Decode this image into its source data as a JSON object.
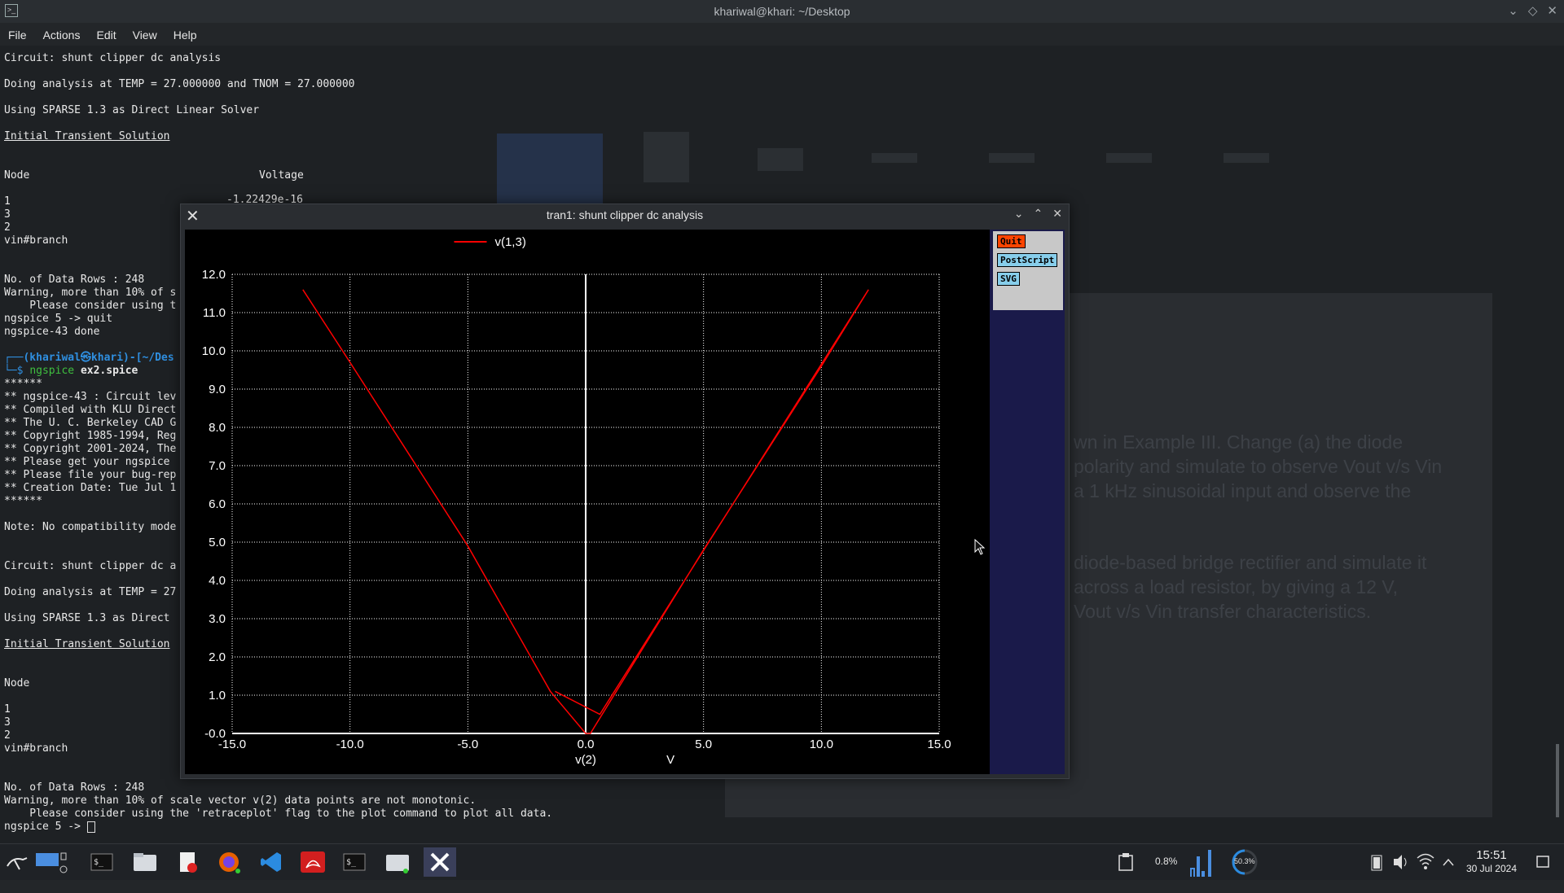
{
  "window": {
    "title": "khariwal@khari: ~/Desktop",
    "app_icon": "terminal-icon"
  },
  "menu": [
    "File",
    "Actions",
    "Edit",
    "View",
    "Help"
  ],
  "terminal_lines": [
    "Circuit: shunt clipper dc analysis",
    "Doing analysis at TEMP = 27.000000 and TNOM = 27.000000",
    "Using SPARSE 1.3 as Direct Linear Solver",
    "Initial Transient Solution",
    "Node",
    "Voltage",
    "-1.22429e-16",
    "1",
    "3",
    "2",
    "vin#branch",
    "No. of Data Rows : 248",
    "Warning, more than 10% of s",
    "    Please consider using t",
    "ngspice 5 -> quit",
    "ngspice-43 done",
    "┌──(khariwal㉿khari)-[~/Des",
    "└─$ ngspice ex2.spice",
    "******",
    "** ngspice-43 : Circuit lev",
    "** Compiled with KLU Direct",
    "** The U. C. Berkeley CAD G",
    "** Copyright 1985-1994, Reg",
    "** Copyright 2001-2024, The",
    "** Please get your ngspice ",
    "** Please file your bug-rep",
    "** Creation Date: Tue Jul 1",
    "******",
    "Note: No compatibility mode",
    "Circuit: shunt clipper dc a",
    "Doing analysis at TEMP = 27",
    "Using SPARSE 1.3 as Direct ",
    "Initial Transient Solution",
    "Node",
    "1",
    "3",
    "2",
    "vin#branch",
    "No. of Data Rows : 248",
    "Warning, more than 10% of scale vector v(2) data points are not monotonic.",
    "    Please consider using the 'retraceplot' flag to the plot command to plot all data.",
    "ngspice 5 -> "
  ],
  "prompt": {
    "user": "khariwal㉿khari",
    "cmd": "ngspice",
    "arg": "ex2.spice"
  },
  "bg_doc_lines": [
    "wn in Example III. Change (a) the diode",
    "polarity and simulate to observe Vout v/s Vin",
    "a 1 kHz sinusoidal input and observe the",
    "diode-based bridge rectifier and simulate it",
    "across a load resistor, by giving a 12 V,",
    "Vout v/s Vin transfer characteristics."
  ],
  "plot_window": {
    "title": "tran1: shunt clipper dc analysis",
    "buttons": [
      "Quit",
      "PostScript",
      "SVG"
    ],
    "colors": {
      "background": "#000000",
      "trace": "#ff0000",
      "grid": "#ffffff",
      "panel": "#1a1a4a"
    }
  },
  "chart_data": {
    "type": "line",
    "xlabel": "v(2)",
    "xunit": "V",
    "xlim": [
      -15,
      15
    ],
    "ylim": [
      0,
      12
    ],
    "xticks": [
      "-15.0",
      "-10.0",
      "-5.0",
      "0.0",
      "5.0",
      "10.0",
      "15.0"
    ],
    "yticks": [
      "-0.0",
      "1.0",
      "2.0",
      "3.0",
      "4.0",
      "5.0",
      "6.0",
      "7.0",
      "8.0",
      "9.0",
      "10.0",
      "11.0",
      "12.0"
    ],
    "grid": true,
    "legend": "top-center",
    "series": [
      {
        "name": "v(1,3)",
        "color": "#ff0000",
        "x": [
          -12.0,
          -10.0,
          -5.0,
          -1.5,
          0.0,
          0.2,
          5.0,
          10.0,
          12.0,
          0.6,
          -1.3
        ],
        "y": [
          11.6,
          9.7,
          4.9,
          1.1,
          0.0,
          0.0,
          4.8,
          9.6,
          11.6,
          0.5,
          1.1
        ]
      }
    ]
  },
  "taskbar": {
    "cpu_percent": "0.8%",
    "mem_percent": "50.3%",
    "time": "15:51",
    "date": "30 Jul 2024"
  }
}
